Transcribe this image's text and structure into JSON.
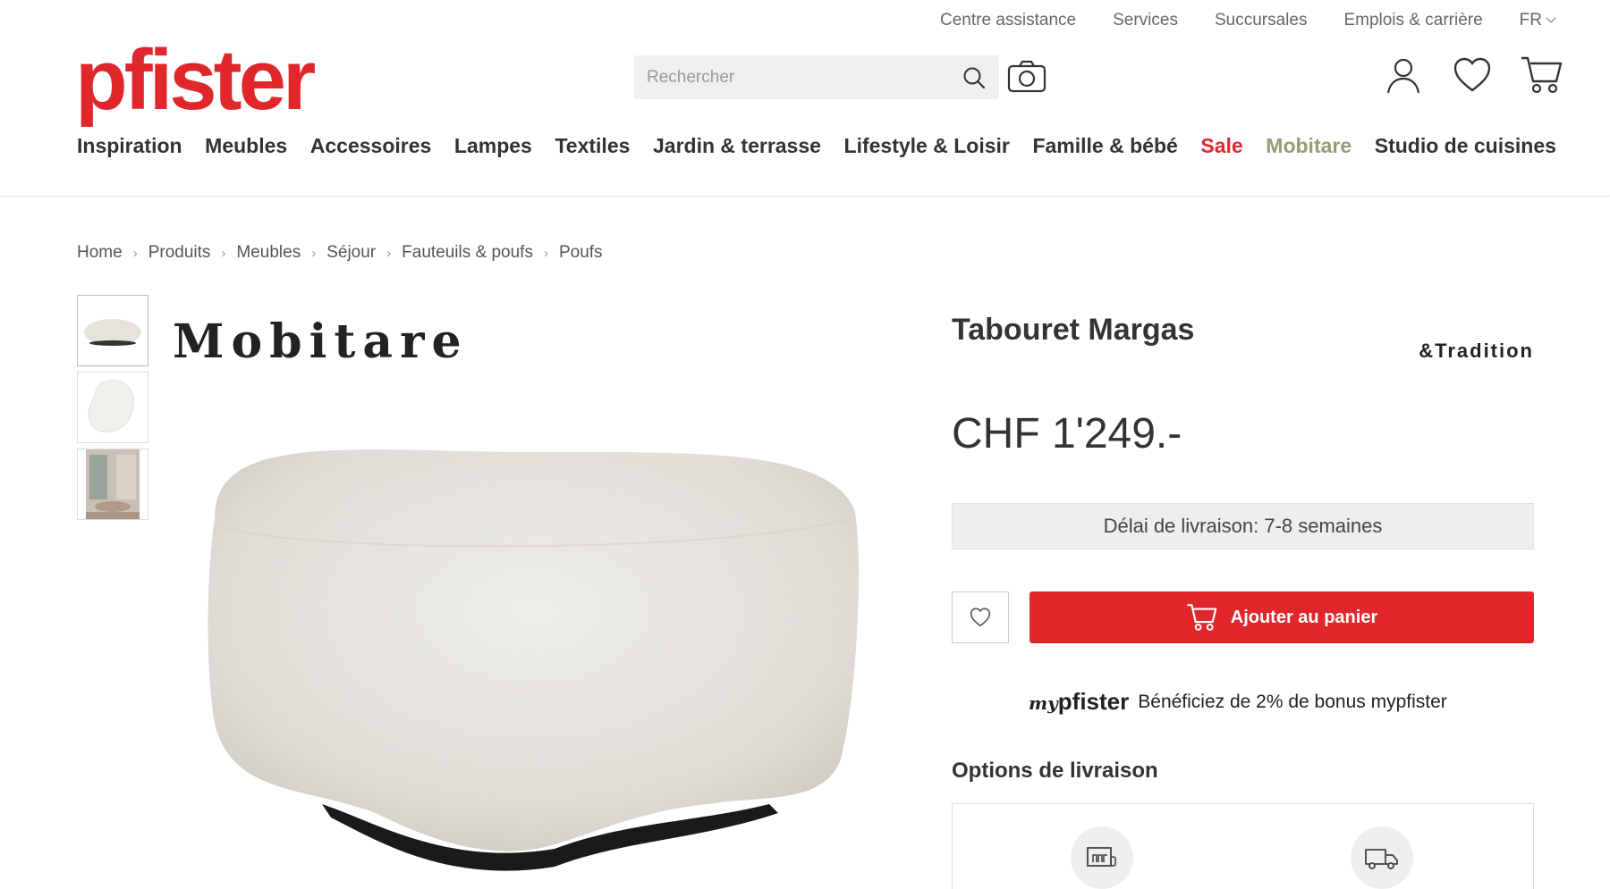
{
  "topbar": {
    "links": [
      "Centre assistance",
      "Services",
      "Succursales",
      "Emplois & carrière"
    ],
    "language": "FR"
  },
  "logo": "pfister",
  "search": {
    "placeholder": "Rechercher"
  },
  "nav": [
    "Inspiration",
    "Meubles",
    "Accessoires",
    "Lampes",
    "Textiles",
    "Jardin & terrasse",
    "Lifestyle & Loisir",
    "Famille & bébé",
    "Sale",
    "Mobitare",
    "Studio de cuisines"
  ],
  "breadcrumb": [
    "Home",
    "Produits",
    "Meubles",
    "Séjour",
    "Fauteuils & poufs",
    "Poufs"
  ],
  "brand_logo": "Mobitare",
  "product": {
    "title": "Tabouret Margas",
    "brand": "&Tradition",
    "price": "CHF 1'249.-",
    "delivery": "Délai de livraison: 7-8 semaines",
    "add_to_cart": "Ajouter au panier",
    "bonus_brand_prefix": "my",
    "bonus_brand": "pfister",
    "bonus_text": "Bénéficiez de 2% de bonus mypfister",
    "options_title": "Options de livraison"
  },
  "colors": {
    "brand": "#e0272c",
    "sale": "#e0272c",
    "mobitare": "#8e9f73"
  }
}
